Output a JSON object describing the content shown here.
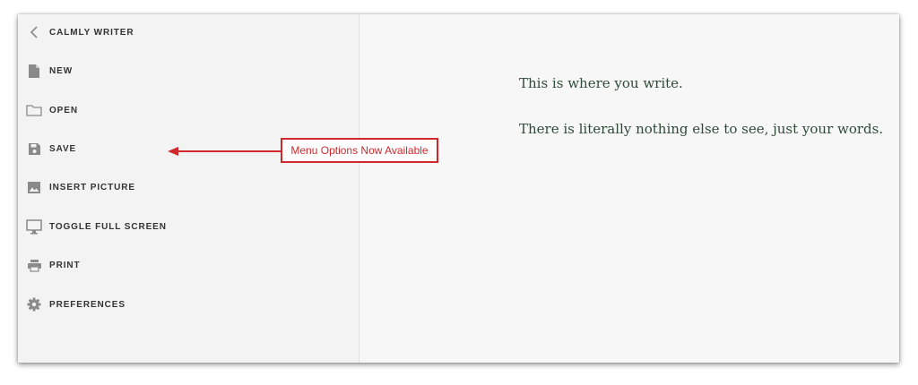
{
  "sidebar": {
    "back_label": "CALMLY WRITER",
    "items": [
      {
        "label": "NEW",
        "icon": "document-icon"
      },
      {
        "label": "OPEN",
        "icon": "folder-icon"
      },
      {
        "label": "SAVE",
        "icon": "floppy-disk-icon"
      },
      {
        "label": "INSERT PICTURE",
        "icon": "image-icon"
      },
      {
        "label": "TOGGLE FULL SCREEN",
        "icon": "monitor-icon"
      },
      {
        "label": "PRINT",
        "icon": "printer-icon"
      },
      {
        "label": "PREFERENCES",
        "icon": "gear-icon"
      }
    ]
  },
  "editor": {
    "paragraphs": [
      "This is where you write.",
      "There is literally nothing else to see, just your words."
    ]
  },
  "annotation": {
    "callout_text": "Menu Options Now Available",
    "color": "#d0282c"
  },
  "colors": {
    "text_green": "#2e4a37",
    "menu_text": "#333333",
    "icon_gray": "#8a8a8a"
  }
}
